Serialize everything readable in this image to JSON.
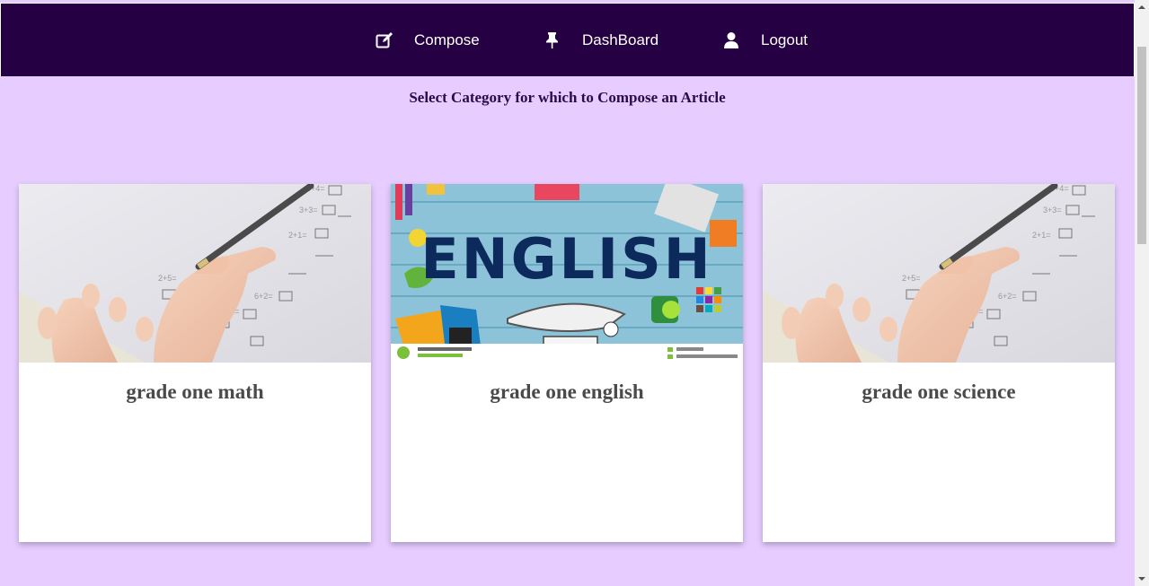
{
  "nav": {
    "items": [
      {
        "label": "Compose",
        "icon": "edit-icon"
      },
      {
        "label": "DashBoard",
        "icon": "pin-icon"
      },
      {
        "label": "Logout",
        "icon": "user-icon"
      }
    ]
  },
  "main": {
    "heading": "Select Category for which to Compose an Article",
    "cards": [
      {
        "title": "grade one math",
        "image": "math-worksheet-photo"
      },
      {
        "title": "grade one english",
        "image": "english-banner-image"
      },
      {
        "title": "grade one science",
        "image": "math-worksheet-photo"
      }
    ]
  },
  "colors": {
    "navbar_bg": "#250042",
    "page_bg": "#e6ccff",
    "heading_text": "#2b0a4a",
    "card_title_text": "#4a4a4a"
  }
}
